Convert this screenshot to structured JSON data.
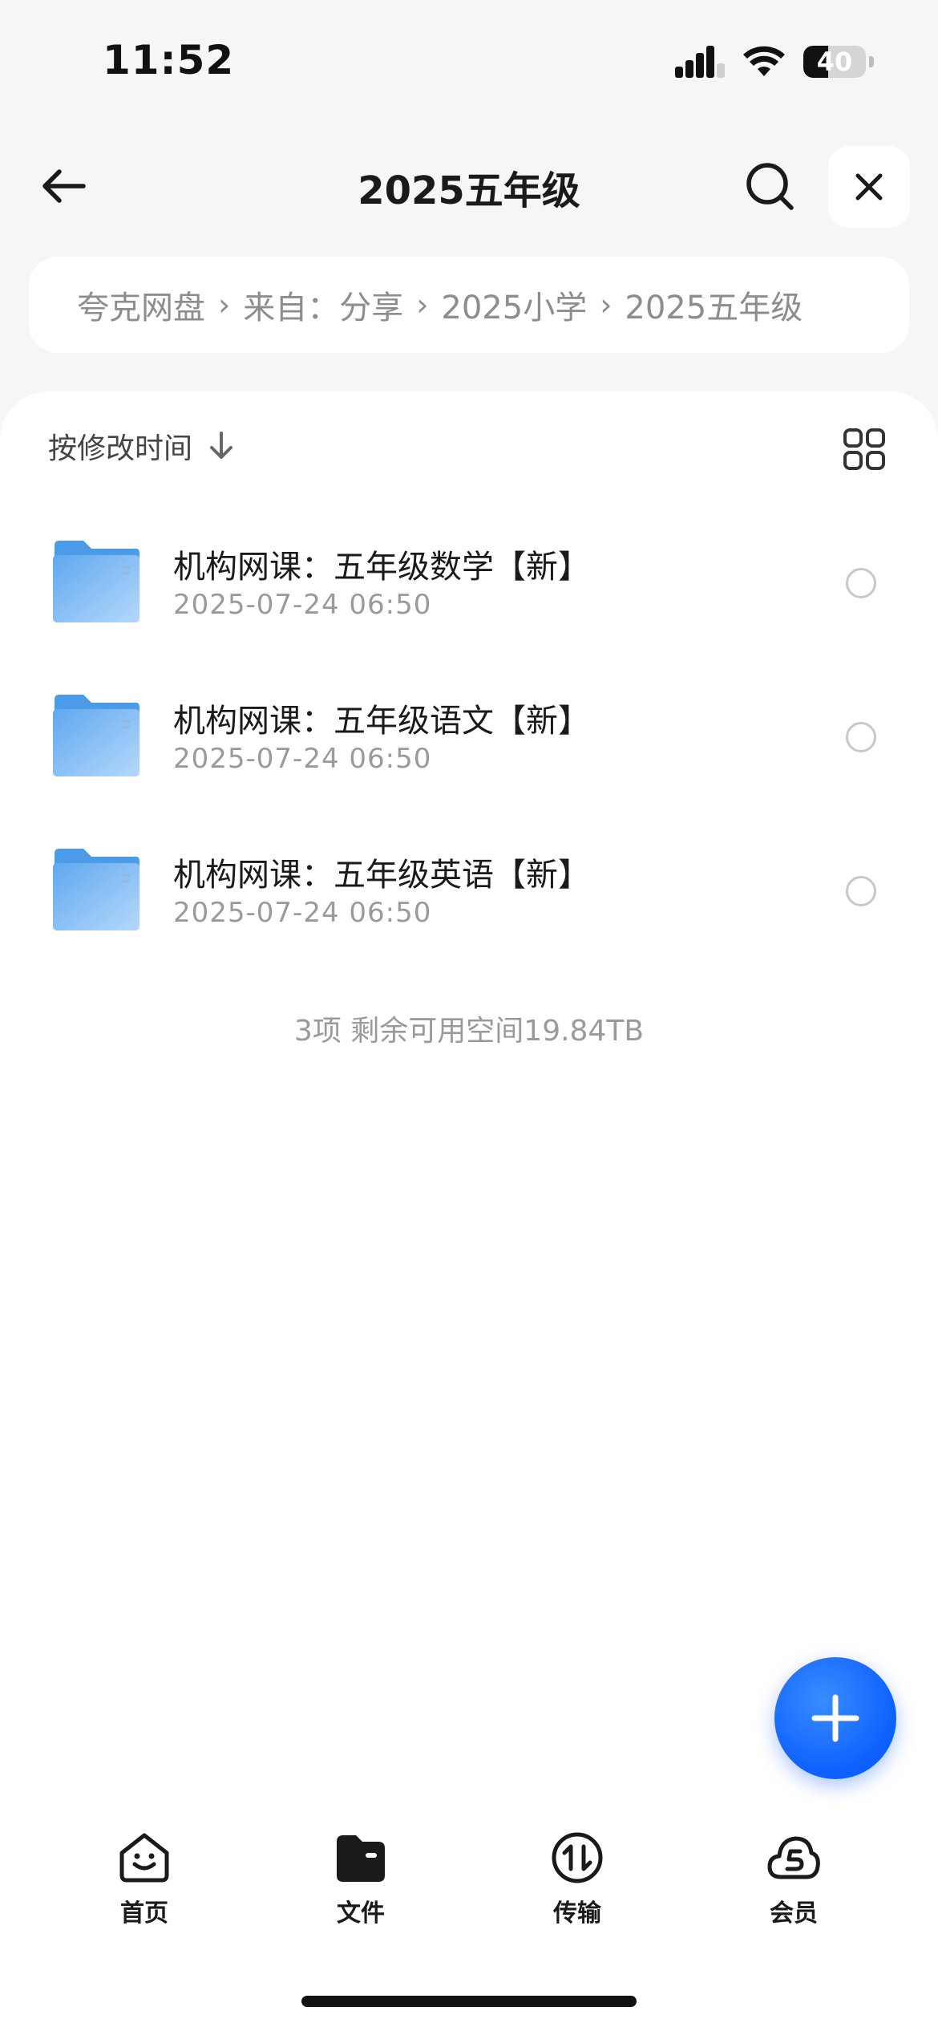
{
  "status_bar": {
    "time": "11:52",
    "battery_level": "40",
    "battery_fraction": 0.4,
    "icons": [
      "cellular-signal-icon",
      "wifi-icon",
      "battery-icon"
    ]
  },
  "header": {
    "title": "2025五年级",
    "icons": [
      "arrow-left-icon",
      "search-icon",
      "close-icon"
    ]
  },
  "breadcrumb": {
    "items": [
      "夸克网盘",
      "来自：分享",
      "2025小学",
      "2025五年级"
    ],
    "separator": "›"
  },
  "list": {
    "sort_label": "按修改时间",
    "files": [
      {
        "name": "机构网课：五年级数学【新】",
        "date": "2025-07-24 06:50"
      },
      {
        "name": "机构网课：五年级语文【新】",
        "date": "2025-07-24 06:50"
      },
      {
        "name": "机构网课：五年级英语【新】",
        "date": "2025-07-24 06:50"
      }
    ],
    "summary": "3项 剩余可用空间19.84TB"
  },
  "tabbar": {
    "tabs": [
      {
        "label": "首页",
        "icon": "home-smile-icon"
      },
      {
        "label": "文件",
        "icon": "folder-icon",
        "active": true
      },
      {
        "label": "传输",
        "icon": "transfer-icon"
      },
      {
        "label": "会员",
        "icon": "cloud-vip-icon"
      }
    ]
  },
  "colors": {
    "accent": "#1563ff",
    "folder": "#6bb0f2",
    "background": "#f6f6f6"
  }
}
